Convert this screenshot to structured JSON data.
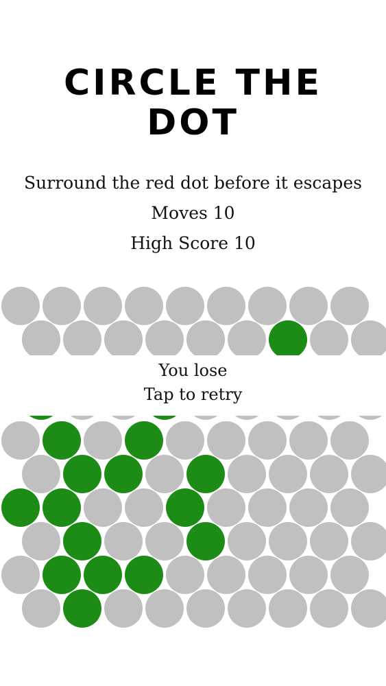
{
  "title": {
    "line1": "CIRCLE THE",
    "line2": "DOT"
  },
  "instructions": "Surround the red dot before it escapes",
  "moves_label": "Moves 10",
  "high_score_label": "High Score 10",
  "result": {
    "line1": "You lose",
    "line2": "Tap to retry"
  },
  "colors": {
    "empty": "#c0c0c0",
    "filled": "#1c8c16",
    "background": "#ffffff"
  },
  "board": {
    "columns": 9,
    "rows": [
      {
        "visible": true,
        "filled": []
      },
      {
        "visible": true,
        "filled": [
          6
        ]
      },
      {
        "visible": false,
        "filled": []
      },
      {
        "visible": false,
        "filled": []
      },
      {
        "visible": true,
        "filled": [
          1,
          3
        ]
      },
      {
        "visible": true,
        "filled": [
          1,
          2,
          4
        ]
      },
      {
        "visible": true,
        "filled": [
          0,
          1,
          4
        ]
      },
      {
        "visible": true,
        "filled": [
          1,
          4
        ]
      },
      {
        "visible": true,
        "filled": [
          1,
          2,
          3
        ]
      },
      {
        "visible": true,
        "filled": [
          1
        ]
      }
    ]
  }
}
